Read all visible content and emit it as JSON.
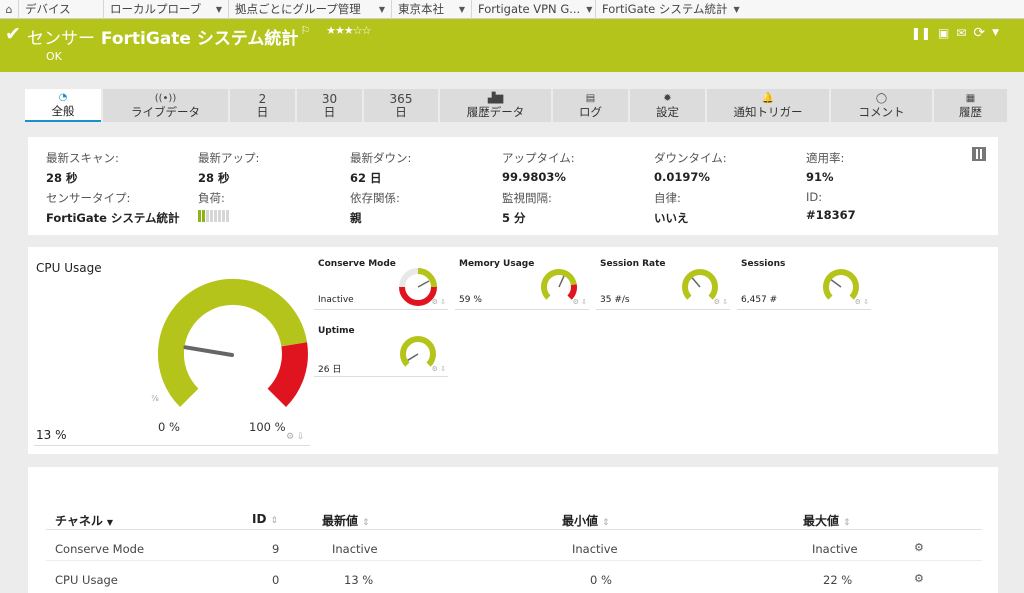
{
  "breadcrumb": [
    {
      "label": "デバイス",
      "caret": false
    },
    {
      "label": "ローカルプローブ",
      "caret": true
    },
    {
      "label": "拠点ごとにグループ管理",
      "caret": true
    },
    {
      "label": "東京本社",
      "caret": true
    },
    {
      "label": "Fortigate VPN G...",
      "caret": true
    },
    {
      "label": "FortiGate システム統計",
      "caret": true
    }
  ],
  "header": {
    "prefix": "センサー",
    "name": "FortiGate システム統計",
    "flag": "⚐",
    "stars": "★★★☆☆",
    "status": "OK",
    "color": "#b4c41b"
  },
  "tabs": [
    {
      "icon": "◔",
      "label": "全般",
      "active": true
    },
    {
      "icon": "((•))",
      "label": "ライブデータ"
    },
    {
      "icon": "2",
      "label": "日"
    },
    {
      "icon": "30",
      "label": "日"
    },
    {
      "icon": "365",
      "label": "日"
    },
    {
      "icon": "▟▆",
      "label": "履歴データ"
    },
    {
      "icon": "▤",
      "label": "ログ"
    },
    {
      "icon": "✹",
      "label": "設定"
    },
    {
      "icon": "🔔",
      "label": "通知トリガー"
    },
    {
      "icon": "◯",
      "label": "コメント"
    },
    {
      "icon": "▦",
      "label": "履歴"
    }
  ],
  "info": {
    "last_scan_label": "最新スキャン:",
    "last_scan": "28 秒",
    "last_up_label": "最新アップ:",
    "last_up": "28 秒",
    "last_down_label": "最新ダウン:",
    "last_down": "62 日",
    "uptime_label": "アップタイム:",
    "uptime": "99.9803%",
    "downtime_label": "ダウンタイム:",
    "downtime": "0.0197%",
    "coverage_label": "適用率:",
    "coverage": "91%",
    "sensor_type_label": "センサータイプ:",
    "sensor_type": "FortiGate システム統計",
    "load_label": "負荷:",
    "load_level": 0.2,
    "dependency_label": "依存関係:",
    "dependency": "親",
    "interval_label": "監視間隔:",
    "interval": "5 分",
    "autonomous_label": "自律:",
    "autonomous": "いいえ",
    "id_label": "ID:",
    "id": "#18367"
  },
  "cpu": {
    "title": "CPU Usage",
    "value": "13 %",
    "min": "0 %",
    "max": "100 %",
    "percent": 13,
    "unit_icon": "⅞"
  },
  "mini_gauges": [
    {
      "title": "Conserve Mode",
      "value": "Inactive",
      "fraction": 0.62,
      "ring": true
    },
    {
      "title": "Memory Usage",
      "value": "59 %",
      "fraction": 0.59,
      "red_zone": true
    },
    {
      "title": "Session Rate",
      "value": "35 #/s",
      "fraction": 0.35
    },
    {
      "title": "Sessions",
      "value": "6,457 #",
      "fraction": 0.3
    },
    {
      "title": "Uptime",
      "value": "26 日",
      "fraction": 0.05
    }
  ],
  "table": {
    "headers": {
      "channel": "チャネル",
      "id": "ID",
      "last": "最新値",
      "min": "最小値",
      "max": "最大値"
    },
    "rows": [
      {
        "channel": "Conserve Mode",
        "id": "9",
        "last": "Inactive",
        "min": "Inactive",
        "max": "Inactive"
      },
      {
        "channel": "CPU Usage",
        "id": "0",
        "last": "13 %",
        "min": "0 %",
        "max": "22 %"
      }
    ]
  }
}
